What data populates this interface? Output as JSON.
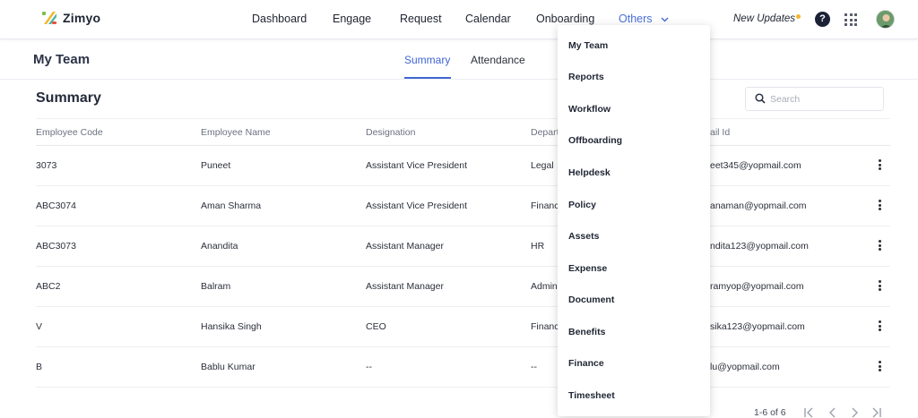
{
  "brand": {
    "name": "Zimyo"
  },
  "nav": {
    "items": [
      "Dashboard",
      "Engage",
      "Request",
      "Calendar",
      "Onboarding"
    ],
    "others_label": "Others",
    "new_updates": "New Updates",
    "help_symbol": "?"
  },
  "subheader": {
    "title": "My Team",
    "tabs": [
      "Summary",
      "Attendance"
    ],
    "active_tab": "Summary"
  },
  "summary": {
    "title": "Summary",
    "search_placeholder": "Search"
  },
  "table": {
    "columns": [
      "Employee Code",
      "Employee Name",
      "Designation",
      "Depart",
      "ail Id"
    ],
    "rows": [
      [
        "3073",
        "Puneet",
        "Assistant Vice President",
        "Legal",
        "eet345@yopmail.com"
      ],
      [
        "ABC3074",
        "Aman Sharma",
        "Assistant Vice President",
        "Financ",
        "anaman@yopmail.com"
      ],
      [
        "ABC3073",
        "Anandita",
        "Assistant Manager",
        "HR",
        "ndita123@yopmail.com"
      ],
      [
        "ABC2",
        "Balram",
        "Assistant Manager",
        "Admin",
        "ramyop@yopmail.com"
      ],
      [
        "V",
        "Hansika Singh",
        "CEO",
        "Financ",
        "sika123@yopmail.com"
      ],
      [
        "B",
        "Bablu Kumar",
        "--",
        "--",
        "lu@yopmail.com"
      ]
    ]
  },
  "pagination": {
    "info": "1-6 of 6"
  },
  "dropdown": {
    "items": [
      "My Team",
      "Reports",
      "Workflow",
      "Offboarding",
      "Helpdesk",
      "Policy",
      "Assets",
      "Expense",
      "Document",
      "Benefits",
      "Finance",
      "Timesheet"
    ]
  },
  "colors": {
    "accent": "#3f66d4",
    "nav_active": "#4a6fd8",
    "badge": "#f5b52a",
    "dark": "#1b2236"
  }
}
